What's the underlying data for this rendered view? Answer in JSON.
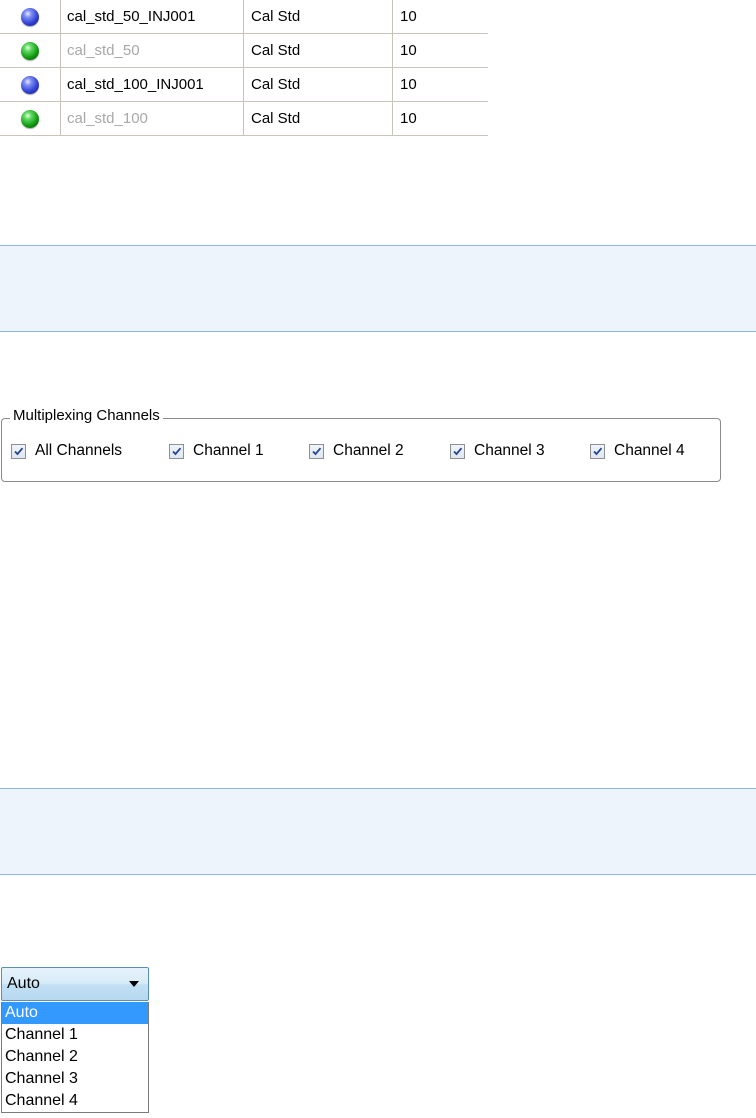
{
  "sample_table": {
    "rows": [
      {
        "status_icon": "blue-ball-icon",
        "name": "cal_std_50_INJ001",
        "type": "Cal Std",
        "value": "10",
        "dimmed": false
      },
      {
        "status_icon": "green-ball-icon",
        "name": "cal_std_50",
        "type": "Cal Std",
        "value": "10",
        "dimmed": true
      },
      {
        "status_icon": "blue-ball-icon",
        "name": "cal_std_100_INJ001",
        "type": "Cal Std",
        "value": "10",
        "dimmed": false
      },
      {
        "status_icon": "green-ball-icon",
        "name": "cal_std_100",
        "type": "Cal Std",
        "value": "10",
        "dimmed": true
      }
    ]
  },
  "multiplexing": {
    "legend": "Multiplexing Channels",
    "options": [
      {
        "label": "All Channels",
        "checked": true
      },
      {
        "label": "Channel 1",
        "checked": true
      },
      {
        "label": "Channel 2",
        "checked": true
      },
      {
        "label": "Channel 3",
        "checked": true
      },
      {
        "label": "Channel 4",
        "checked": true
      }
    ]
  },
  "channel_select": {
    "value": "Auto",
    "options": [
      "Auto",
      "Channel 1",
      "Channel 2",
      "Channel 3",
      "Channel 4"
    ],
    "highlighted_index": 0
  },
  "colors": {
    "info_band_bg": "#eef4fb",
    "info_band_border": "#8fb7d9",
    "selection_highlight": "#3399ff",
    "dimmed_text": "#a8a8a8"
  }
}
